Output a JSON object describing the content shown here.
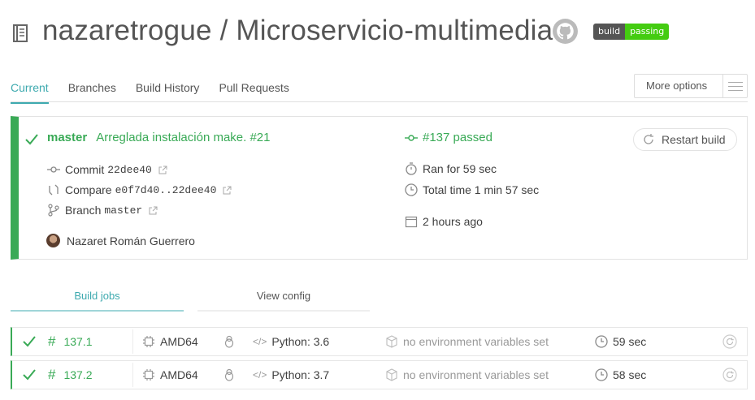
{
  "header": {
    "title": "nazaretrogue / Microservicio-multimedia",
    "badge_left": "build",
    "badge_right": "passing"
  },
  "tabs": [
    "Current",
    "Branches",
    "Build History",
    "Pull Requests"
  ],
  "more_options": "More options",
  "build": {
    "branch": "master",
    "message": "Arreglada instalación make. #21",
    "number": "#137 passed",
    "commit_label": "Commit",
    "commit_hash": "22dee40",
    "compare_label": "Compare",
    "compare_range": "e0f7d40..22dee40",
    "branch_label": "Branch",
    "branch_name": "master",
    "author": "Nazaret Román Guerrero",
    "ran_for": "Ran for 59 sec",
    "total_time": "Total time 1 min 57 sec",
    "ago": "2 hours ago",
    "restart": "Restart build"
  },
  "job_tabs": {
    "build_jobs": "Build jobs",
    "view_config": "View config"
  },
  "jobs": [
    {
      "id": "137.1",
      "arch": "AMD64",
      "lang": "Python: 3.6",
      "env": "no environment variables set",
      "duration": "59 sec"
    },
    {
      "id": "137.2",
      "arch": "AMD64",
      "lang": "Python: 3.7",
      "env": "no environment variables set",
      "duration": "58 sec"
    }
  ],
  "colors": {
    "passed": "#39aa56",
    "accent": "#3eaaaf"
  }
}
